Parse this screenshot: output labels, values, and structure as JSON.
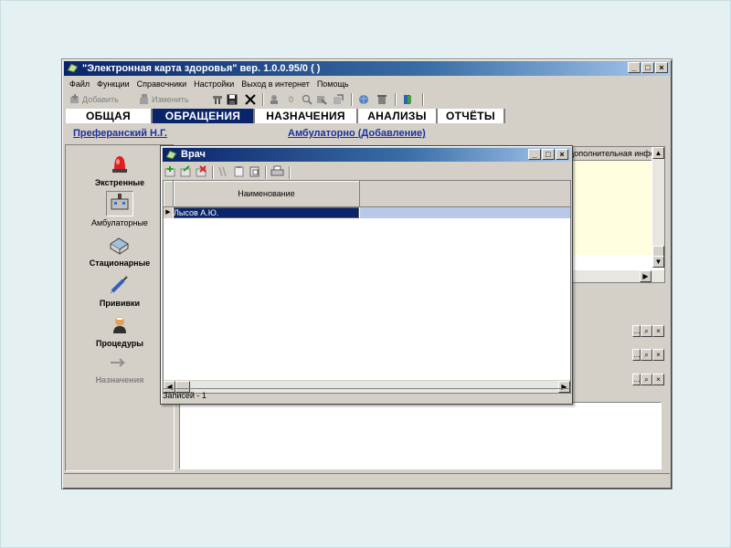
{
  "window": {
    "title": "\"Электронная карта здоровья\" вер. 1.0.0.95/0 ( )",
    "btn_min": "_",
    "btn_max": "□",
    "btn_close": "×"
  },
  "menu": [
    "Файл",
    "Функции",
    "Справочники",
    "Настройки",
    "Выход в интернет",
    "Помощь"
  ],
  "toolbar": {
    "add_label": "Добавить",
    "edit_label": "Изменить",
    "zero_label": "0"
  },
  "tabs": [
    "ОБЩАЯ",
    "ОБРАЩЕНИЯ",
    "НАЗНАЧЕНИЯ",
    "АНАЛИЗЫ",
    "ОТЧЁТЫ"
  ],
  "patient": {
    "name": "Преферанский Н.Г.",
    "mode": "Амбулаторно (Добавление)"
  },
  "sidebar": [
    {
      "label": "Экстренные",
      "icon": "siren-icon"
    },
    {
      "label": "Амбулаторные",
      "icon": "clinic-icon"
    },
    {
      "label": "Стационарные",
      "icon": "hospital-bed-icon"
    },
    {
      "label": "Прививки",
      "icon": "syringe-icon"
    },
    {
      "label": "Процедуры",
      "icon": "procedure-icon"
    },
    {
      "label": "Назначения",
      "icon": "arrow-icon"
    }
  ],
  "right_panel": {
    "column_header": "дополнительная инфо"
  },
  "dialog": {
    "title": "Врач",
    "column_header": "Наименование",
    "rows": [
      "Лысов А.Ю."
    ],
    "status": "Записей - 1"
  },
  "colors": {
    "title_bar": "#0a246a",
    "active_tab": "#0a246a",
    "link": "#1c2fa0",
    "selected_row": "#0a246a",
    "background": "#e4f0f2"
  }
}
